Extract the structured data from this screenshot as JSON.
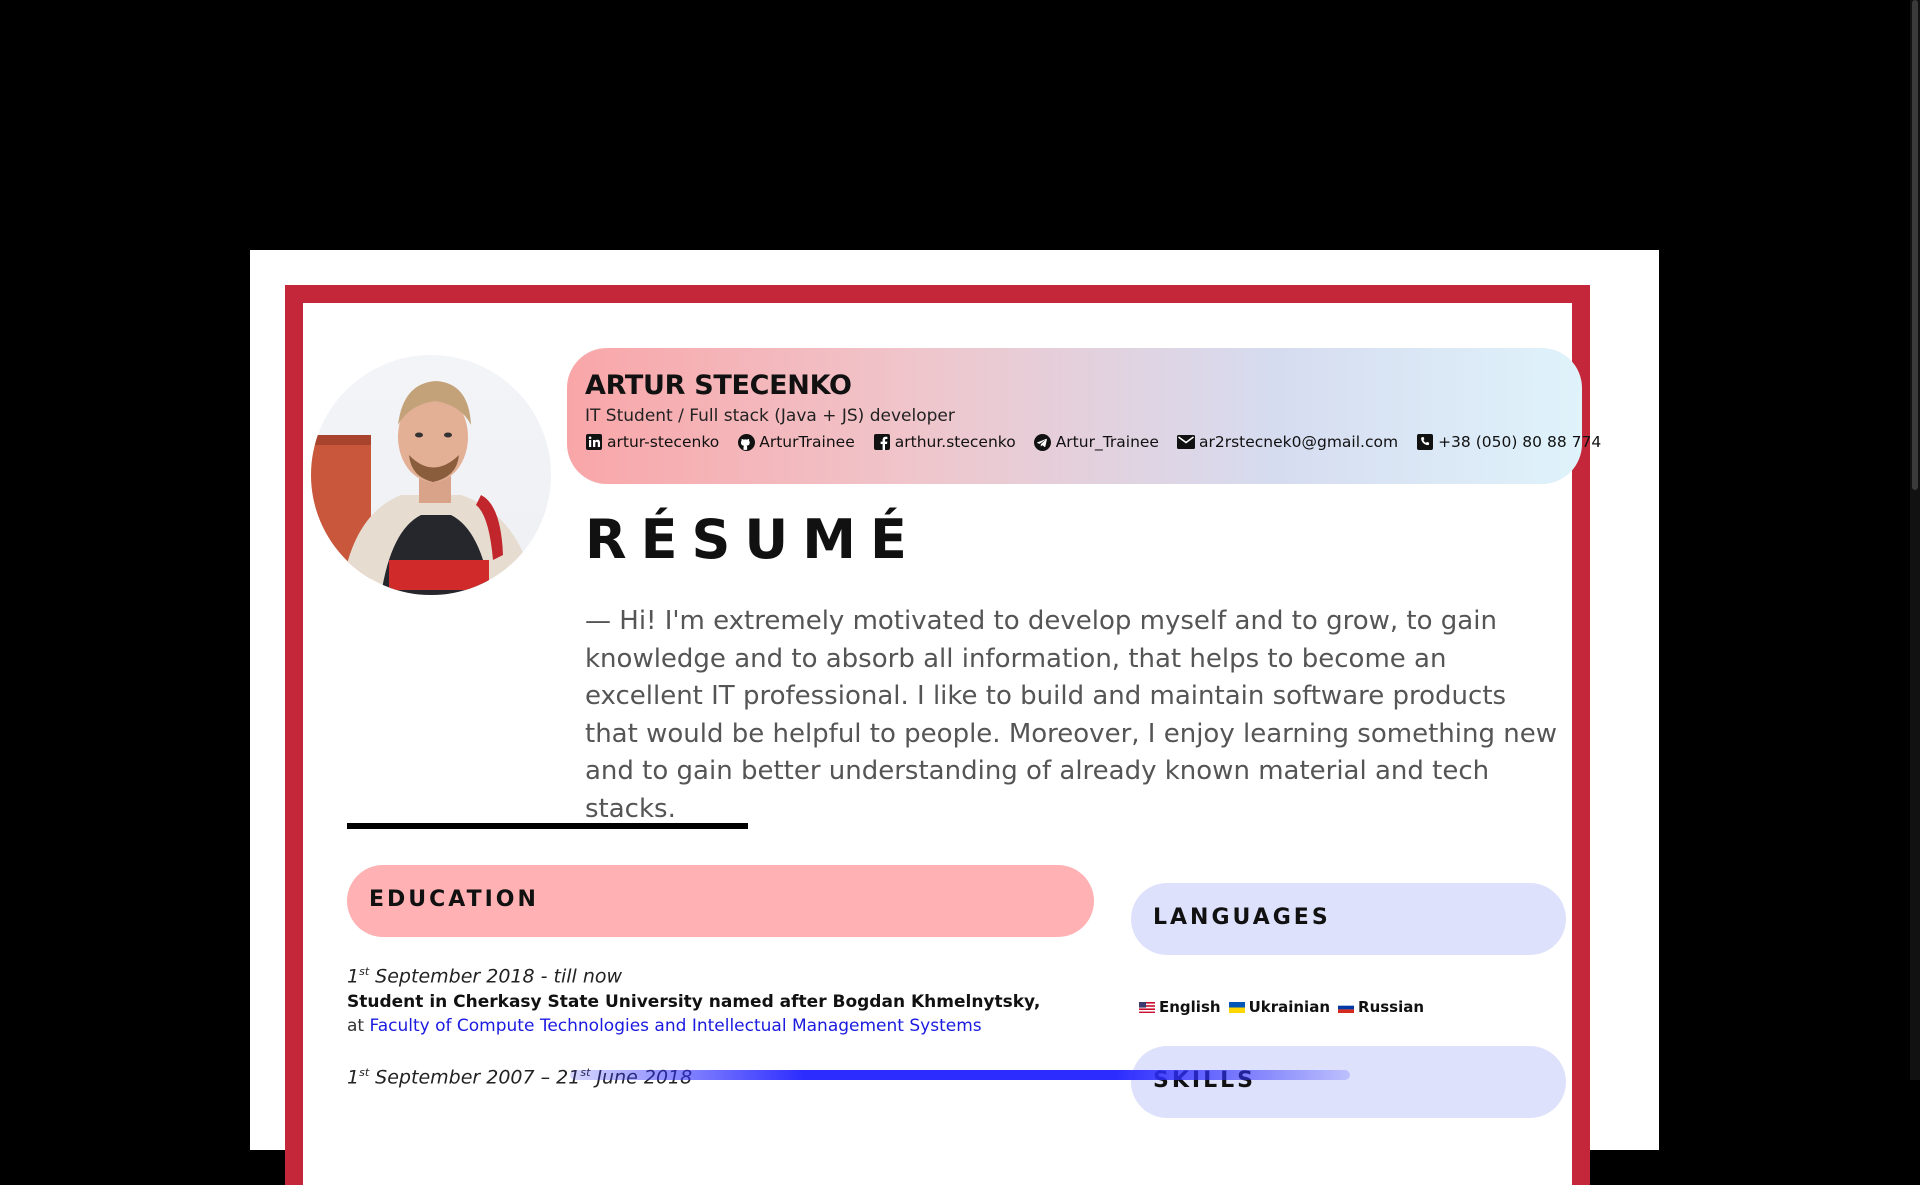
{
  "profile": {
    "name": "ARTUR STECENKO",
    "subtitle": "IT Student / Full stack (Java + JS) developer",
    "contacts": [
      {
        "icon": "linkedin-icon",
        "label": "artur-stecenko"
      },
      {
        "icon": "github-icon",
        "label": "ArturTrainee"
      },
      {
        "icon": "facebook-icon",
        "label": "arthur.stecenko"
      },
      {
        "icon": "telegram-icon",
        "label": "Artur_Trainee"
      },
      {
        "icon": "mail-icon",
        "label": "ar2rstecnek0@gmail.com"
      },
      {
        "icon": "phone-icon",
        "label": "+38 (050) 80 88 774"
      }
    ]
  },
  "resume": {
    "title": "RÉSUMÉ",
    "intro": "— Hi! I'm extremely motivated to develop myself and to grow, to gain knowledge and to absorb all information, that helps to become an excellent IT professional. I like to build and maintain software products that would be helpful to people. Moreover, I enjoy learning something new and to gain better understanding of already known material and tech stacks."
  },
  "education": {
    "heading": "EDUCATION",
    "items": [
      {
        "day": "1",
        "sup": "st",
        "date_rest": " September 2018 - till now",
        "line": "Student in Cherkasy State University named after Bogdan Khmelnytsky,",
        "at_prefix": "at ",
        "link": "Faculty of Compute Technologies and Intellectual Management Systems"
      },
      {
        "day": "1",
        "sup": "st",
        "date_mid": " September 2007 – 21",
        "sup2": "st",
        "date_rest": " June 2018"
      }
    ]
  },
  "languages": {
    "heading": "LANGUAGES",
    "items": [
      {
        "flag": "us-flag-icon",
        "label": "English"
      },
      {
        "flag": "ukraine-flag-icon",
        "label": "Ukrainian"
      },
      {
        "flag": "russia-flag-icon",
        "label": "Russian"
      }
    ]
  },
  "skills": {
    "heading": "SKILLS"
  },
  "colors": {
    "frame": "#c4263a",
    "education_pill": "#ffb1b3",
    "side_pill": "#dde1fb",
    "link": "#1a1ae0"
  }
}
